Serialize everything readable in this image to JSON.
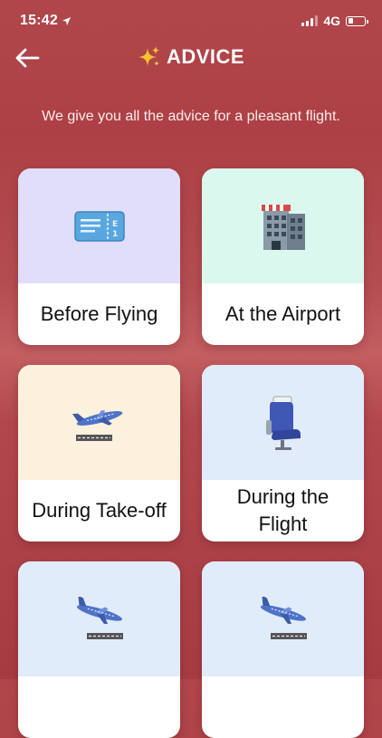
{
  "status_bar": {
    "time": "15:42",
    "network": "4G",
    "battery_level": 0.3
  },
  "header": {
    "title": "ADVICE",
    "icon": "sparkles-icon"
  },
  "intro": "We give you all the advice for a pleasant flight.",
  "cards": [
    {
      "label": "Before Flying",
      "icon": "ticket-icon",
      "color": "#e0defa"
    },
    {
      "label": "At the Airport",
      "icon": "hotel-building-icon",
      "color": "#dbf8ee"
    },
    {
      "label": "During Take-off",
      "icon": "airplane-departure-icon",
      "color": "#fcf1dc"
    },
    {
      "label": "During the Flight",
      "icon": "airplane-seat-icon",
      "color": "#e1ecfb"
    },
    {
      "label": "",
      "icon": "airplane-arrival-icon",
      "color": "#e1ecfb"
    },
    {
      "label": "",
      "icon": "airplane-arrival-icon",
      "color": "#e1ecfb"
    }
  ]
}
